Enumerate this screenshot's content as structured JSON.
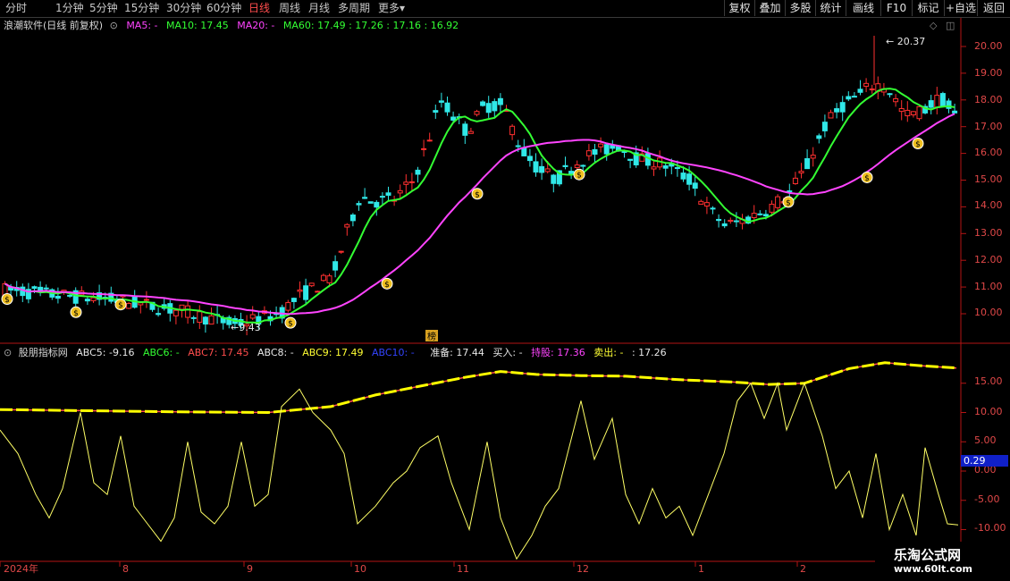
{
  "periods": [
    "分时",
    "1分钟",
    "5分钟",
    "15分钟",
    "30分钟",
    "60分钟",
    "日线",
    "周线",
    "月线",
    "多周期",
    "更多"
  ],
  "active_period": "日线",
  "more_arrow": "▾",
  "tools": [
    "复权",
    "叠加",
    "多股",
    "统计",
    "画线",
    "F10",
    "标记",
    "+自选",
    "返回"
  ],
  "main_chart": {
    "title": "浪潮软件(日线 前复权)",
    "ma_labels": [
      {
        "text": "MA5: -",
        "color": "#ff44ff"
      },
      {
        "text": "MA10: 17.45",
        "color": "#33ff33"
      },
      {
        "text": "MA20: -",
        "color": "#ff44ff"
      },
      {
        "text": "MA60: 17.49 : 17.26 : 17.16 : 16.92",
        "color": "#33ff33"
      }
    ],
    "high_marker": "20.37",
    "low_marker": "9.43",
    "rank_label": "榜",
    "price_ticks": [
      "20.00",
      "19.00",
      "18.00",
      "17.00",
      "16.00",
      "15.00",
      "14.00",
      "13.00",
      "12.00",
      "11.00",
      "10.00"
    ]
  },
  "sub_chart": {
    "title": "股朋指标网",
    "labels": [
      {
        "text": "ABC5: -9.16",
        "color": "#e8e8e8"
      },
      {
        "text": "ABC6: -",
        "color": "#33ff33"
      },
      {
        "text": "ABC7: 17.45",
        "color": "#ff4d4d"
      },
      {
        "text": "ABC8: -",
        "color": "#e8e8e8"
      },
      {
        "text": "ABC9: 17.49",
        "color": "#ffff33"
      },
      {
        "text": "ABC10: -",
        "color": "#3344ff"
      },
      {
        "text": "准备: 17.44",
        "color": "#e8e8e8"
      },
      {
        "text": "买入: -",
        "color": "#e8e8e8"
      },
      {
        "text": "持股: 17.36",
        "color": "#ff44ff"
      },
      {
        "text": "卖出: -",
        "color": "#ffff33"
      },
      {
        "text": ": 17.26",
        "color": "#e8e8e8"
      }
    ],
    "value_ticks": [
      "15.00",
      "10.00",
      "5.00",
      "0.00",
      "-5.00",
      "-10.00"
    ],
    "current_value": "0.29"
  },
  "date_axis": [
    "2024年",
    "8",
    "9",
    "10",
    "11",
    "12",
    "1",
    "2"
  ],
  "brand": {
    "name": "乐淘公式网",
    "url": "www.60lt.com"
  },
  "chart_data": [
    {
      "type": "candlestick",
      "title": "浪潮软件(日线 前复权)",
      "ylim": [
        9.0,
        21.0
      ],
      "y_ticks": [
        10,
        11,
        12,
        13,
        14,
        15,
        16,
        17,
        18,
        19,
        20
      ],
      "x_labels": [
        "2024年",
        "8",
        "9",
        "10",
        "11",
        "12",
        "1",
        "2"
      ],
      "annotations": [
        {
          "text": "20.37",
          "type": "high"
        },
        {
          "text": "9.43",
          "type": "low"
        }
      ],
      "series": [
        {
          "name": "MA10",
          "last": 17.45
        },
        {
          "name": "MA60",
          "last": 16.92
        }
      ]
    },
    {
      "type": "line",
      "title": "股朋指标网",
      "ylim": [
        -11,
        20
      ],
      "y_ticks": [
        -10,
        -5,
        0,
        5,
        10,
        15
      ],
      "series": [
        {
          "name": "ABC5",
          "last": -9.16,
          "color": "#ffff55"
        },
        {
          "name": "ABC9",
          "last": 17.49,
          "color": "#ffff00"
        },
        {
          "name": "ABC7",
          "last": 17.45,
          "color": "#ff4d4d"
        }
      ]
    }
  ]
}
